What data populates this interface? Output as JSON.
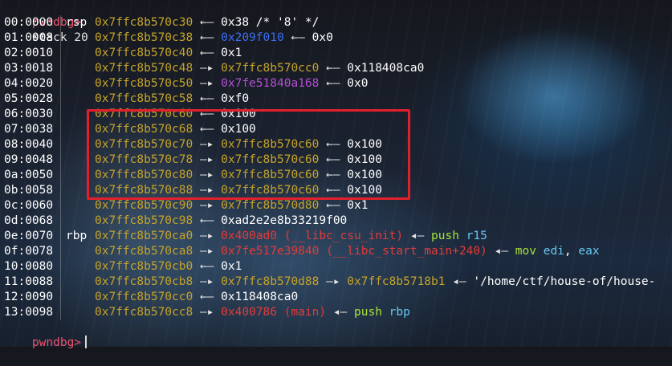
{
  "prompt": "pwndbg>",
  "command": "stack 20",
  "colors": {
    "stack": "#c4a32b",
    "heap": "#3d6df0",
    "mmap": "#b34fd4",
    "code": "#e23b3b",
    "insn": "#a8e33a",
    "prompt": "#f0506e",
    "highlight": "#e2202c"
  },
  "rows": [
    {
      "off": "00:0000",
      "reg": "rsp",
      "chain": [
        {
          "t": "stack",
          "v": "0x7ffc8b570c30"
        },
        {
          "t": "arr",
          "v": " ←— "
        },
        {
          "t": "val",
          "v": "0x38 /* '8' */"
        }
      ]
    },
    {
      "off": "01:0008",
      "reg": "",
      "chain": [
        {
          "t": "stack",
          "v": "0x7ffc8b570c38"
        },
        {
          "t": "arr",
          "v": " ←— "
        },
        {
          "t": "heap",
          "v": "0x209f010"
        },
        {
          "t": "arr",
          "v": " ←— "
        },
        {
          "t": "val",
          "v": "0x0"
        }
      ]
    },
    {
      "off": "02:0010",
      "reg": "",
      "chain": [
        {
          "t": "stack",
          "v": "0x7ffc8b570c40"
        },
        {
          "t": "arr",
          "v": " ←— "
        },
        {
          "t": "val",
          "v": "0x1"
        }
      ]
    },
    {
      "off": "03:0018",
      "reg": "",
      "chain": [
        {
          "t": "stack",
          "v": "0x7ffc8b570c48"
        },
        {
          "t": "arr",
          "v": " —▸ "
        },
        {
          "t": "stack",
          "v": "0x7ffc8b570cc0"
        },
        {
          "t": "arr",
          "v": " ←— "
        },
        {
          "t": "val",
          "v": "0x118408ca0"
        }
      ]
    },
    {
      "off": "04:0020",
      "reg": "",
      "chain": [
        {
          "t": "stack",
          "v": "0x7ffc8b570c50"
        },
        {
          "t": "arr",
          "v": " —▸ "
        },
        {
          "t": "mmap",
          "v": "0x7fe51840a168"
        },
        {
          "t": "arr",
          "v": " ←— "
        },
        {
          "t": "val",
          "v": "0x0"
        }
      ]
    },
    {
      "off": "05:0028",
      "reg": "",
      "chain": [
        {
          "t": "stack",
          "v": "0x7ffc8b570c58"
        },
        {
          "t": "arr",
          "v": " ←— "
        },
        {
          "t": "val",
          "v": "0xf0"
        }
      ]
    },
    {
      "off": "06:0030",
      "reg": "",
      "chain": [
        {
          "t": "stack",
          "v": "0x7ffc8b570c60"
        },
        {
          "t": "arr",
          "v": " ←— "
        },
        {
          "t": "val",
          "v": "0x100"
        }
      ]
    },
    {
      "off": "07:0038",
      "reg": "",
      "chain": [
        {
          "t": "stack",
          "v": "0x7ffc8b570c68"
        },
        {
          "t": "arr",
          "v": " ←— "
        },
        {
          "t": "val",
          "v": "0x100"
        }
      ]
    },
    {
      "off": "08:0040",
      "reg": "",
      "chain": [
        {
          "t": "stack",
          "v": "0x7ffc8b570c70"
        },
        {
          "t": "arr",
          "v": " —▸ "
        },
        {
          "t": "stack",
          "v": "0x7ffc8b570c60"
        },
        {
          "t": "arr",
          "v": " ←— "
        },
        {
          "t": "val",
          "v": "0x100"
        }
      ]
    },
    {
      "off": "09:0048",
      "reg": "",
      "chain": [
        {
          "t": "stack",
          "v": "0x7ffc8b570c78"
        },
        {
          "t": "arr",
          "v": " —▸ "
        },
        {
          "t": "stack",
          "v": "0x7ffc8b570c60"
        },
        {
          "t": "arr",
          "v": " ←— "
        },
        {
          "t": "val",
          "v": "0x100"
        }
      ]
    },
    {
      "off": "0a:0050",
      "reg": "",
      "chain": [
        {
          "t": "stack",
          "v": "0x7ffc8b570c80"
        },
        {
          "t": "arr",
          "v": " —▸ "
        },
        {
          "t": "stack",
          "v": "0x7ffc8b570c60"
        },
        {
          "t": "arr",
          "v": " ←— "
        },
        {
          "t": "val",
          "v": "0x100"
        }
      ]
    },
    {
      "off": "0b:0058",
      "reg": "",
      "chain": [
        {
          "t": "stack",
          "v": "0x7ffc8b570c88"
        },
        {
          "t": "arr",
          "v": " —▸ "
        },
        {
          "t": "stack",
          "v": "0x7ffc8b570c60"
        },
        {
          "t": "arr",
          "v": " ←— "
        },
        {
          "t": "val",
          "v": "0x100"
        }
      ]
    },
    {
      "off": "0c:0060",
      "reg": "",
      "chain": [
        {
          "t": "stack",
          "v": "0x7ffc8b570c90"
        },
        {
          "t": "arr",
          "v": " —▸ "
        },
        {
          "t": "stack",
          "v": "0x7ffc8b570d80"
        },
        {
          "t": "arr",
          "v": " ←— "
        },
        {
          "t": "val",
          "v": "0x1"
        }
      ]
    },
    {
      "off": "0d:0068",
      "reg": "",
      "chain": [
        {
          "t": "stack",
          "v": "0x7ffc8b570c98"
        },
        {
          "t": "arr",
          "v": " ←— "
        },
        {
          "t": "val",
          "v": "0xad2e2e8b33219f00"
        }
      ]
    },
    {
      "off": "0e:0070",
      "reg": "rbp",
      "chain": [
        {
          "t": "stack",
          "v": "0x7ffc8b570ca0"
        },
        {
          "t": "arr",
          "v": " —▸ "
        },
        {
          "t": "code",
          "v": "0x400ad0 (__libc_csu_init)"
        },
        {
          "t": "arr",
          "v": " ◂— "
        },
        {
          "t": "insn",
          "v": "push "
        },
        {
          "t": "op",
          "v": "r15"
        }
      ]
    },
    {
      "off": "0f:0078",
      "reg": "",
      "chain": [
        {
          "t": "stack",
          "v": "0x7ffc8b570ca8"
        },
        {
          "t": "arr",
          "v": " —▸ "
        },
        {
          "t": "code",
          "v": "0x7fe517e39840 (__libc_start_main+240)"
        },
        {
          "t": "arr",
          "v": " ◂— "
        },
        {
          "t": "insn",
          "v": "mov "
        },
        {
          "t": "op",
          "v": "edi"
        },
        {
          "t": "val",
          "v": ", "
        },
        {
          "t": "op",
          "v": "eax"
        }
      ]
    },
    {
      "off": "10:0080",
      "reg": "",
      "chain": [
        {
          "t": "stack",
          "v": "0x7ffc8b570cb0"
        },
        {
          "t": "arr",
          "v": " ←— "
        },
        {
          "t": "val",
          "v": "0x1"
        }
      ]
    },
    {
      "off": "11:0088",
      "reg": "",
      "chain": [
        {
          "t": "stack",
          "v": "0x7ffc8b570cb8"
        },
        {
          "t": "arr",
          "v": " —▸ "
        },
        {
          "t": "stack",
          "v": "0x7ffc8b570d88"
        },
        {
          "t": "arr",
          "v": " —▸ "
        },
        {
          "t": "stack",
          "v": "0x7ffc8b5718b1"
        },
        {
          "t": "arr",
          "v": " ◂— "
        },
        {
          "t": "val",
          "v": "'/home/ctf/house-of/house-"
        }
      ]
    },
    {
      "off": "12:0090",
      "reg": "",
      "chain": [
        {
          "t": "stack",
          "v": "0x7ffc8b570cc0"
        },
        {
          "t": "arr",
          "v": " ←— "
        },
        {
          "t": "val",
          "v": "0x118408ca0"
        }
      ]
    },
    {
      "off": "13:0098",
      "reg": "",
      "chain": [
        {
          "t": "stack",
          "v": "0x7ffc8b570cc8"
        },
        {
          "t": "arr",
          "v": " —▸ "
        },
        {
          "t": "code",
          "v": "0x400786 (main)"
        },
        {
          "t": "arr",
          "v": " ◂— "
        },
        {
          "t": "insn",
          "v": "push "
        },
        {
          "t": "op",
          "v": "rbp"
        }
      ]
    }
  ]
}
